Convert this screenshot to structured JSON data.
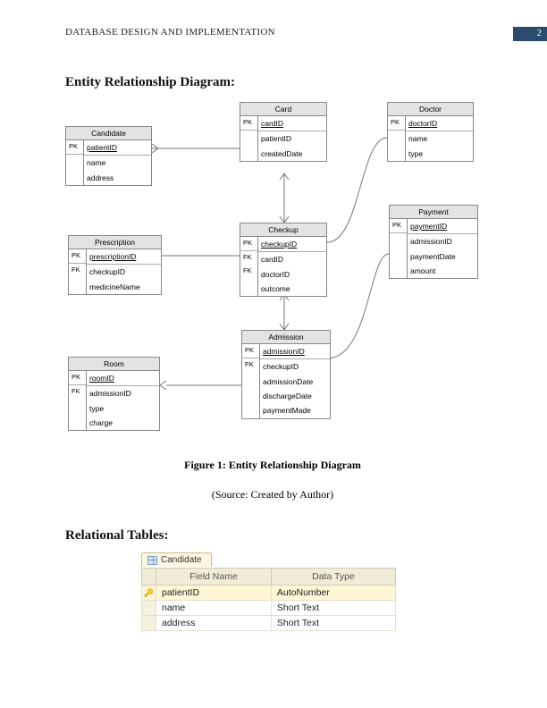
{
  "header": {
    "title": "DATABASE DESIGN AND IMPLEMENTATION",
    "pageNumber": "2"
  },
  "section1": "Entity Relationship Diagram:",
  "figureCaption": "Figure 1: Entity Relationship Diagram",
  "figureSource": "(Source: Created by Author)",
  "section2": "Relational Tables:",
  "entities": {
    "candidate": {
      "name": "Candidate",
      "keys": [
        "PK",
        "",
        ""
      ],
      "attrs": [
        "patientID",
        "name",
        "address"
      ],
      "pkIdx": 0,
      "hrAfter": 0
    },
    "card": {
      "name": "Card",
      "keys": [
        "PK",
        "",
        ""
      ],
      "attrs": [
        "cardID",
        "patientID",
        "createdDate"
      ],
      "pkIdx": 0,
      "hrAfter": 0
    },
    "doctor": {
      "name": "Doctor",
      "keys": [
        "PK",
        "",
        ""
      ],
      "attrs": [
        "doctorID",
        "name",
        "type"
      ],
      "pkIdx": 0,
      "hrAfter": 0
    },
    "prescription": {
      "name": "Prescription",
      "keys": [
        "PK",
        "FK",
        ""
      ],
      "attrs": [
        "prescriptionID",
        "checkupID",
        "medicineName"
      ],
      "pkIdx": 0,
      "hrAfter": 0
    },
    "checkup": {
      "name": "Checkup",
      "keys": [
        "PK",
        "FK",
        "FK",
        ""
      ],
      "attrs": [
        "checkupID",
        "cardID",
        "doctorID",
        "outcome"
      ],
      "pkIdx": 0,
      "hrAfter": 0
    },
    "payment": {
      "name": "Payment",
      "keys": [
        "PK",
        "",
        "",
        ""
      ],
      "attrs": [
        "paymentID",
        "admissionID",
        "paymentDate",
        "amount"
      ],
      "pkIdx": 0,
      "hrAfter": 0
    },
    "room": {
      "name": "Room",
      "keys": [
        "PK",
        "FK",
        "",
        ""
      ],
      "attrs": [
        "roomID",
        "admissionID",
        "type",
        "charge"
      ],
      "pkIdx": 0,
      "hrAfter": 0
    },
    "admission": {
      "name": "Admission",
      "keys": [
        "PK",
        "FK",
        "",
        "",
        ""
      ],
      "attrs": [
        "admissionID",
        "checkupID",
        "admissionDate",
        "dischargeDate",
        "paymentMade"
      ],
      "pkIdx": 0,
      "hrAfter": 0
    }
  },
  "relTable": {
    "tabLabel": "Candidate",
    "headers": [
      "Field Name",
      "Data Type"
    ],
    "rows": [
      {
        "selected": true,
        "key": true,
        "field": "patientID",
        "type": "AutoNumber"
      },
      {
        "selected": false,
        "key": false,
        "field": "name",
        "type": "Short Text"
      },
      {
        "selected": false,
        "key": false,
        "field": "address",
        "type": "Short Text"
      }
    ]
  }
}
